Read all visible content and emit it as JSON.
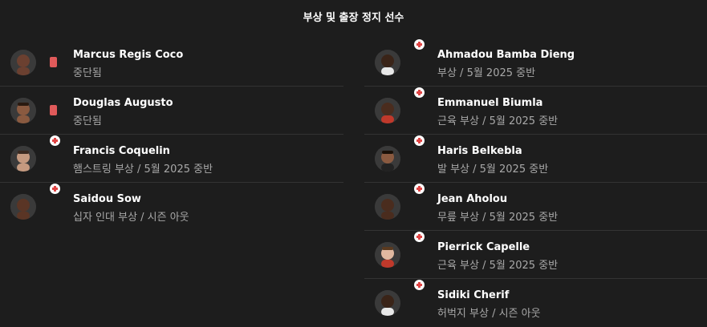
{
  "title": "부상 및 출장 정지 선수",
  "colors": {
    "card": "#e05a5a",
    "injury_cross": "#e04545",
    "background": "#1d1d1d"
  },
  "left_players": [
    {
      "name": "Marcus Regis Coco",
      "reason": "중단됨",
      "status_icon": "red-card-icon"
    },
    {
      "name": "Douglas Augusto",
      "reason": "중단됨",
      "status_icon": "red-card-icon"
    },
    {
      "name": "Francis Coquelin",
      "reason": "햄스트링 부상 / 5월 2025 중반",
      "status_icon": "injury-icon"
    },
    {
      "name": "Saidou Sow",
      "reason": "십자 인대 부상 / 시즌 아웃",
      "status_icon": "injury-icon"
    }
  ],
  "right_players": [
    {
      "name": "Ahmadou Bamba Dieng",
      "reason": "부상 / 5월 2025 중반",
      "status_icon": "injury-icon"
    },
    {
      "name": "Emmanuel Biumla",
      "reason": "근육 부상 / 5월 2025 중반",
      "status_icon": "injury-icon"
    },
    {
      "name": "Haris Belkebla",
      "reason": "발 부상 / 5월 2025 중반",
      "status_icon": "injury-icon"
    },
    {
      "name": "Jean Aholou",
      "reason": "무릎 부상 / 5월 2025 중반",
      "status_icon": "injury-icon"
    },
    {
      "name": "Pierrick Capelle",
      "reason": "근육 부상 / 5월 2025 중반",
      "status_icon": "injury-icon"
    },
    {
      "name": "Sidiki Cherif",
      "reason": "허벅지 부상 / 시즌 아웃",
      "status_icon": "injury-icon"
    }
  ]
}
